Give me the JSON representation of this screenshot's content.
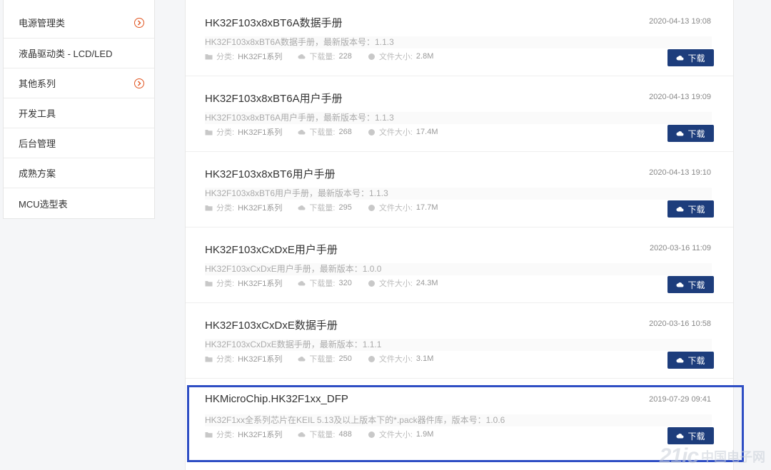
{
  "sidebar": {
    "items": [
      {
        "label": "电源管理类",
        "has_arrow": true
      },
      {
        "label": "液晶驱动类 - LCD/LED",
        "has_arrow": false
      },
      {
        "label": "其他系列",
        "has_arrow": true
      },
      {
        "label": "开发工具",
        "has_arrow": false
      },
      {
        "label": "后台管理",
        "has_arrow": false
      },
      {
        "label": "成熟方案",
        "has_arrow": false
      },
      {
        "label": "MCU选型表",
        "has_arrow": false
      }
    ]
  },
  "labels": {
    "category": "分类:",
    "downloads": "下载量:",
    "size": "文件大小:",
    "download_button": "下载"
  },
  "documents": [
    {
      "title": "HK32F103x8xBT6A数据手册",
      "date": "2020-04-13 19:08",
      "desc": "HK32F103x8xBT6A数据手册，最新版本号：1.1.3",
      "category": "HK32F1系列",
      "downloads": "228",
      "size": "2.8M"
    },
    {
      "title": "HK32F103x8xBT6A用户手册",
      "date": "2020-04-13 19:09",
      "desc": "HK32F103x8xBT6A用户手册，最新版本号：1.1.3",
      "category": "HK32F1系列",
      "downloads": "268",
      "size": "17.4M"
    },
    {
      "title": "HK32F103x8xBT6用户手册",
      "date": "2020-04-13 19:10",
      "desc": "HK32F103x8xBT6用户手册，最新版本号：1.1.3",
      "category": "HK32F1系列",
      "downloads": "295",
      "size": "17.7M"
    },
    {
      "title": "HK32F103xCxDxE用户手册",
      "date": "2020-03-16 11:09",
      "desc": "HK32F103xCxDxE用户手册，最新版本：1.0.0",
      "category": "HK32F1系列",
      "downloads": "320",
      "size": "24.3M"
    },
    {
      "title": "HK32F103xCxDxE数据手册",
      "date": "2020-03-16 10:58",
      "desc": "HK32F103xCxDxE数据手册，最新版本：1.1.1",
      "category": "HK32F1系列",
      "downloads": "250",
      "size": "3.1M"
    },
    {
      "title": "HKMicroChip.HK32F1xx_DFP",
      "date": "2019-07-29 09:41",
      "desc": "HK32F1xx全系列芯片在KEIL 5.13及以上版本下的*.pack器件库，版本号：1.0.6",
      "category": "HK32F1系列",
      "downloads": "488",
      "size": "1.9M"
    }
  ],
  "watermark": {
    "logo": "21ic",
    "text": "中国电子网"
  },
  "colors": {
    "accent": "#1d3d7c",
    "arrow": "#e0541f",
    "highlight": "#2e4ec4"
  }
}
